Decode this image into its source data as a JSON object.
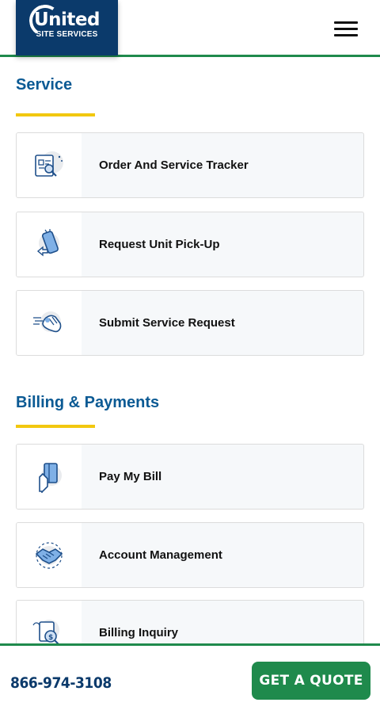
{
  "header": {
    "logo_main": "United",
    "logo_sub": "SITE SERVICES"
  },
  "sections": [
    {
      "title": "Service",
      "items": [
        {
          "label": "Order And Service Tracker",
          "icon": "document-search-icon"
        },
        {
          "label": "Request Unit Pick-Up",
          "icon": "phone-tap-icon"
        },
        {
          "label": "Submit Service Request",
          "icon": "hand-tap-icon"
        }
      ]
    },
    {
      "title": "Billing & Payments",
      "items": [
        {
          "label": "Pay My Bill",
          "icon": "credit-card-hand-icon"
        },
        {
          "label": "Account Management",
          "icon": "handshake-icon"
        },
        {
          "label": "Billing Inquiry",
          "icon": "invoice-search-icon"
        }
      ]
    }
  ],
  "footer": {
    "phone": "866-974-3108",
    "quote_label": "GET A QUOTE"
  },
  "colors": {
    "brand_navy": "#0b3a6b",
    "heading_blue": "#0b5a94",
    "accent_green": "#1f8a4c",
    "accent_yellow": "#f2c80f"
  }
}
